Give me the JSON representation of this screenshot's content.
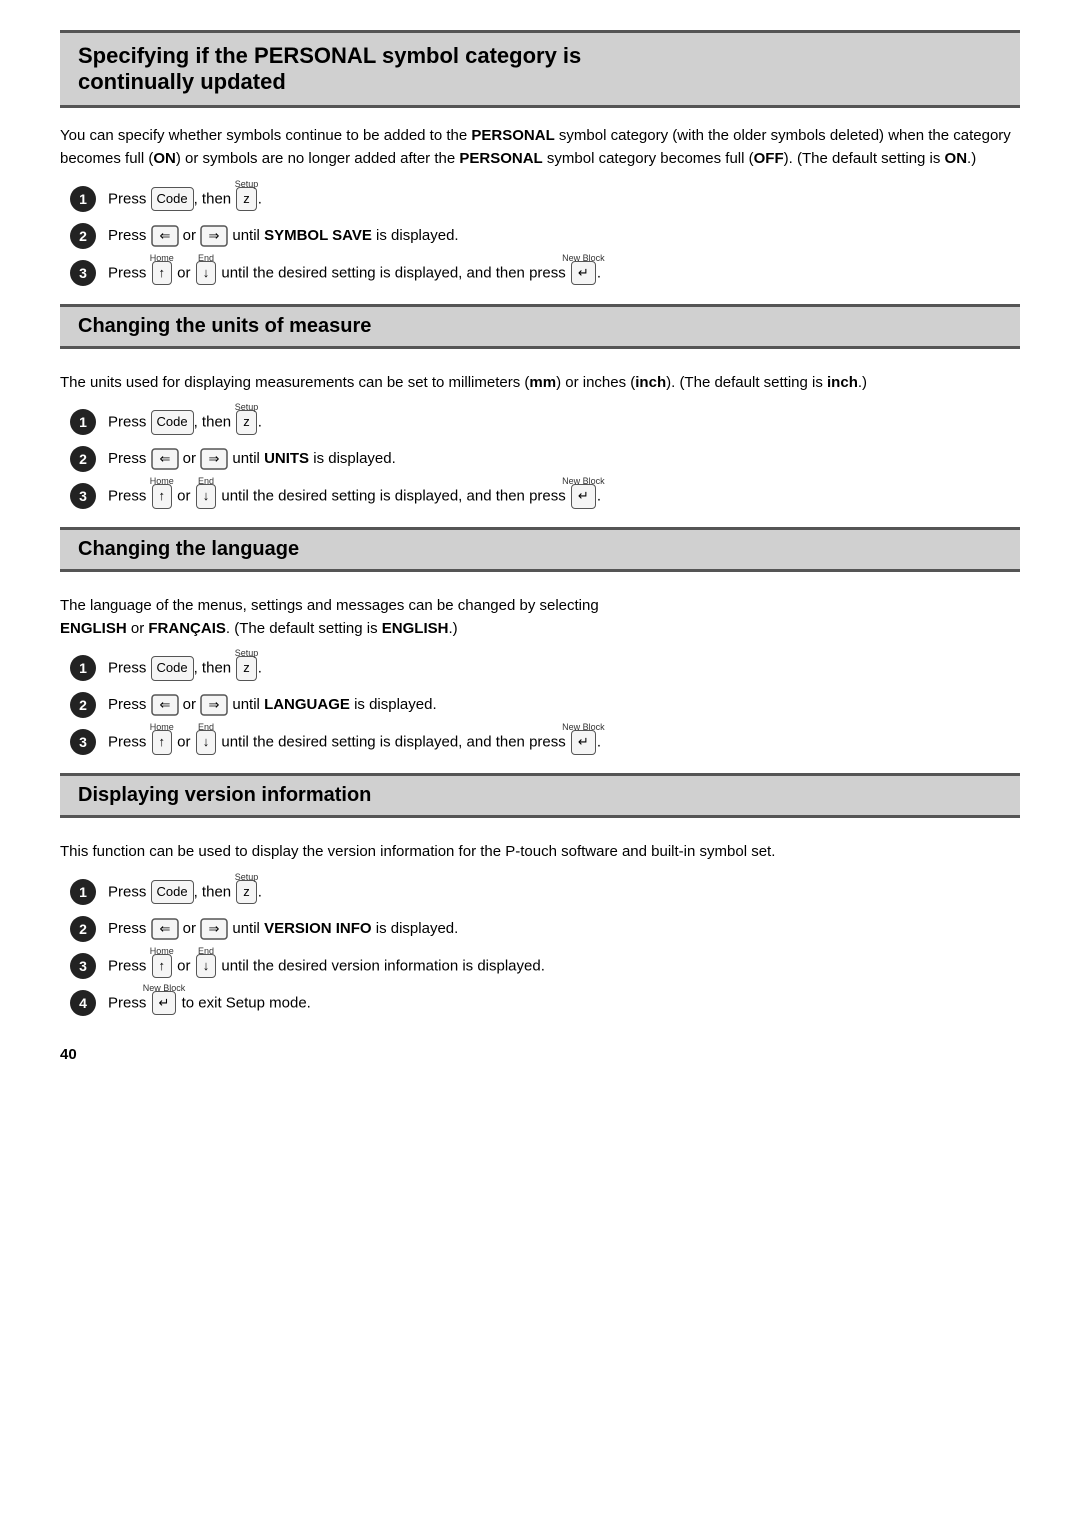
{
  "page": {
    "number": "40"
  },
  "section1": {
    "title_line1": "Specifying if the PERSONAL symbol category is",
    "title_line2": "continually updated",
    "body": "You can specify whether symbols continue to be added to the PERSONAL symbol category (with the older symbols deleted) when the category becomes full (ON) or symbols are no longer added after the PERSONAL symbol category becomes full (OFF). (The default setting is ON.)",
    "steps": [
      {
        "num": "1",
        "text": "Press Code, then Z (Setup)."
      },
      {
        "num": "2",
        "text": "Press ← or → until SYMBOL SAVE is displayed."
      },
      {
        "num": "3",
        "text": "Press ↑ (Home) or ↓ (End) until the desired setting is displayed, and then press ↵ (New Block)."
      }
    ]
  },
  "section2": {
    "title": "Changing the units of measure",
    "body": "The units used for displaying measurements can be set to millimeters (mm) or inches (inch). (The default setting is inch.)",
    "steps": [
      {
        "num": "1",
        "text": "Press Code, then Z (Setup)."
      },
      {
        "num": "2",
        "text": "Press ← or → until UNITS is displayed."
      },
      {
        "num": "3",
        "text": "Press ↑ (Home) or ↓ (End) until the desired setting is displayed, and then press ↵ (New Block)."
      }
    ]
  },
  "section3": {
    "title": "Changing the language",
    "body1": "The language of the menus, settings and messages can be changed by selecting",
    "body2": "ENGLISH or FRANÇAIS. (The default setting is ENGLISH.)",
    "steps": [
      {
        "num": "1",
        "text": "Press Code, then Z (Setup)."
      },
      {
        "num": "2",
        "text": "Press ← or → until LANGUAGE is displayed."
      },
      {
        "num": "3",
        "text": "Press ↑ (Home) or ↓ (End) until the desired setting is displayed, and then press ↵ (New Block)."
      }
    ]
  },
  "section4": {
    "title": "Displaying version information",
    "body": "This function can be used to display the version information for the P-touch software and built-in symbol set.",
    "steps": [
      {
        "num": "1",
        "text": "Press Code, then Z (Setup)."
      },
      {
        "num": "2",
        "text": "Press ← or → until VERSION INFO is displayed."
      },
      {
        "num": "3",
        "text": "Press ↑ (Home) or ↓ (End) until the desired version information is displayed."
      },
      {
        "num": "4",
        "text": "Press ↵ (New Block) to exit Setup mode."
      }
    ]
  },
  "labels": {
    "code": "Code",
    "setup": "Setup",
    "z": "z",
    "left_arrow": "←",
    "right_arrow": "→",
    "up_arrow": "↑",
    "down_arrow": "↓",
    "enter": "↵",
    "home": "Home",
    "end": "End",
    "new_block": "New Block",
    "symbol_save": "SYMBOL SAVE",
    "units": "UNITS",
    "language": "LANGUAGE",
    "version_info": "VERSION INFO",
    "personal": "PERSONAL",
    "on": "ON",
    "off": "OFF",
    "mm": "mm",
    "inch": "inch",
    "english": "ENGLISH",
    "francais": "FRANÇAIS"
  }
}
